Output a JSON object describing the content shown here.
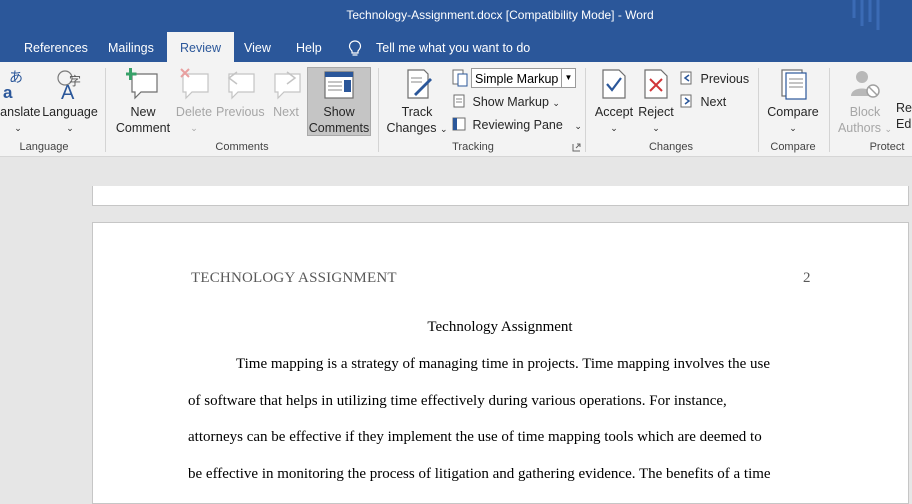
{
  "window": {
    "title": "Technology-Assignment.docx [Compatibility Mode]  -  Word"
  },
  "menu": {
    "tabs": [
      {
        "label": "References"
      },
      {
        "label": "Mailings"
      },
      {
        "label": "Review"
      },
      {
        "label": "View"
      },
      {
        "label": "Help"
      }
    ],
    "tell_me": "Tell me what you want to do",
    "accent_color": "#2b579a"
  },
  "ribbon": {
    "language_group": {
      "translate": "ranslate",
      "language": "Language",
      "label": "Language"
    },
    "comments_group": {
      "new_comment": [
        "New",
        "Comment"
      ],
      "delete": "Delete",
      "previous": "Previous",
      "next": "Next",
      "show_comments": [
        "Show",
        "Comments"
      ],
      "label": "Comments"
    },
    "tracking_group": {
      "track_changes": [
        "Track",
        "Changes"
      ],
      "markup_select": "Simple Markup",
      "show_markup": "Show Markup",
      "reviewing_pane": "Reviewing Pane",
      "label": "Tracking"
    },
    "changes_group": {
      "accept": "Accept",
      "reject": "Reject",
      "previous": "Previous",
      "next": "Next",
      "label": "Changes"
    },
    "compare_group": {
      "compare": "Compare",
      "label": "Compare"
    },
    "protect_group": {
      "block_authors": [
        "Block",
        "Authors"
      ],
      "restrict_editing": [
        "Res",
        "Ed"
      ],
      "label": "Protect"
    }
  },
  "document": {
    "header_title": "TECHNOLOGY ASSIGNMENT",
    "page_number": "2",
    "heading": "Technology Assignment",
    "lines": [
      "Time mapping is a strategy of managing time in projects. Time mapping involves the use",
      "of software that helps in utilizing time effectively during various operations. For instance,",
      "attorneys can be effective if they implement the use of time mapping tools which are deemed to",
      "be effective in monitoring the process of litigation and gathering evidence. The benefits of a time"
    ]
  }
}
